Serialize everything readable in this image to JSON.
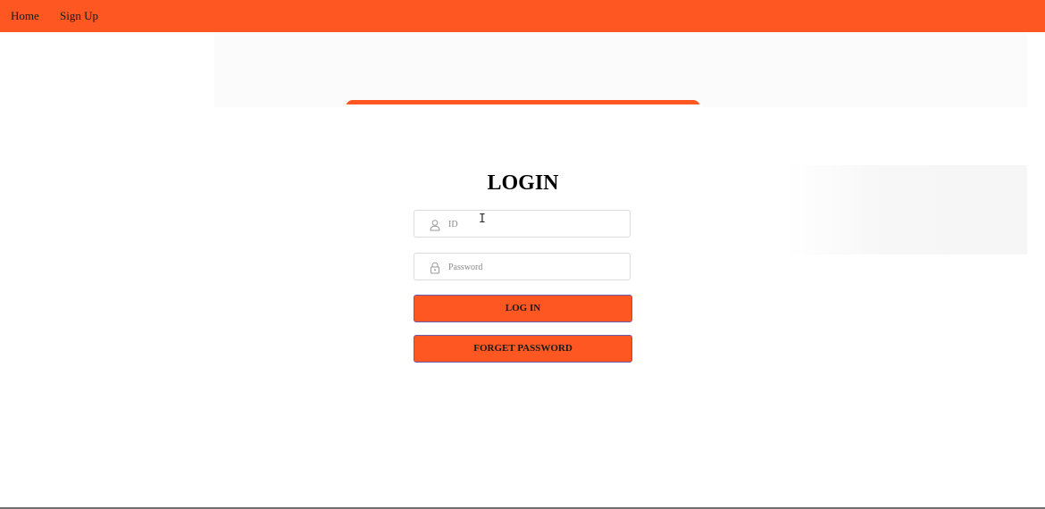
{
  "nav": {
    "home_label": "Home",
    "signup_label": "Sign Up"
  },
  "login": {
    "title": "LOGIN",
    "id_placeholder": "ID",
    "password_placeholder": "Password",
    "login_button": "LOG IN",
    "forget_button": "FORGET PASSWORD"
  },
  "icons": {
    "id_field": "user-icon",
    "password_field": "lock-icon",
    "cursor": "text-cursor-icon"
  },
  "colors": {
    "accent": "#ff5722",
    "button_border": "#6b5bb0"
  }
}
